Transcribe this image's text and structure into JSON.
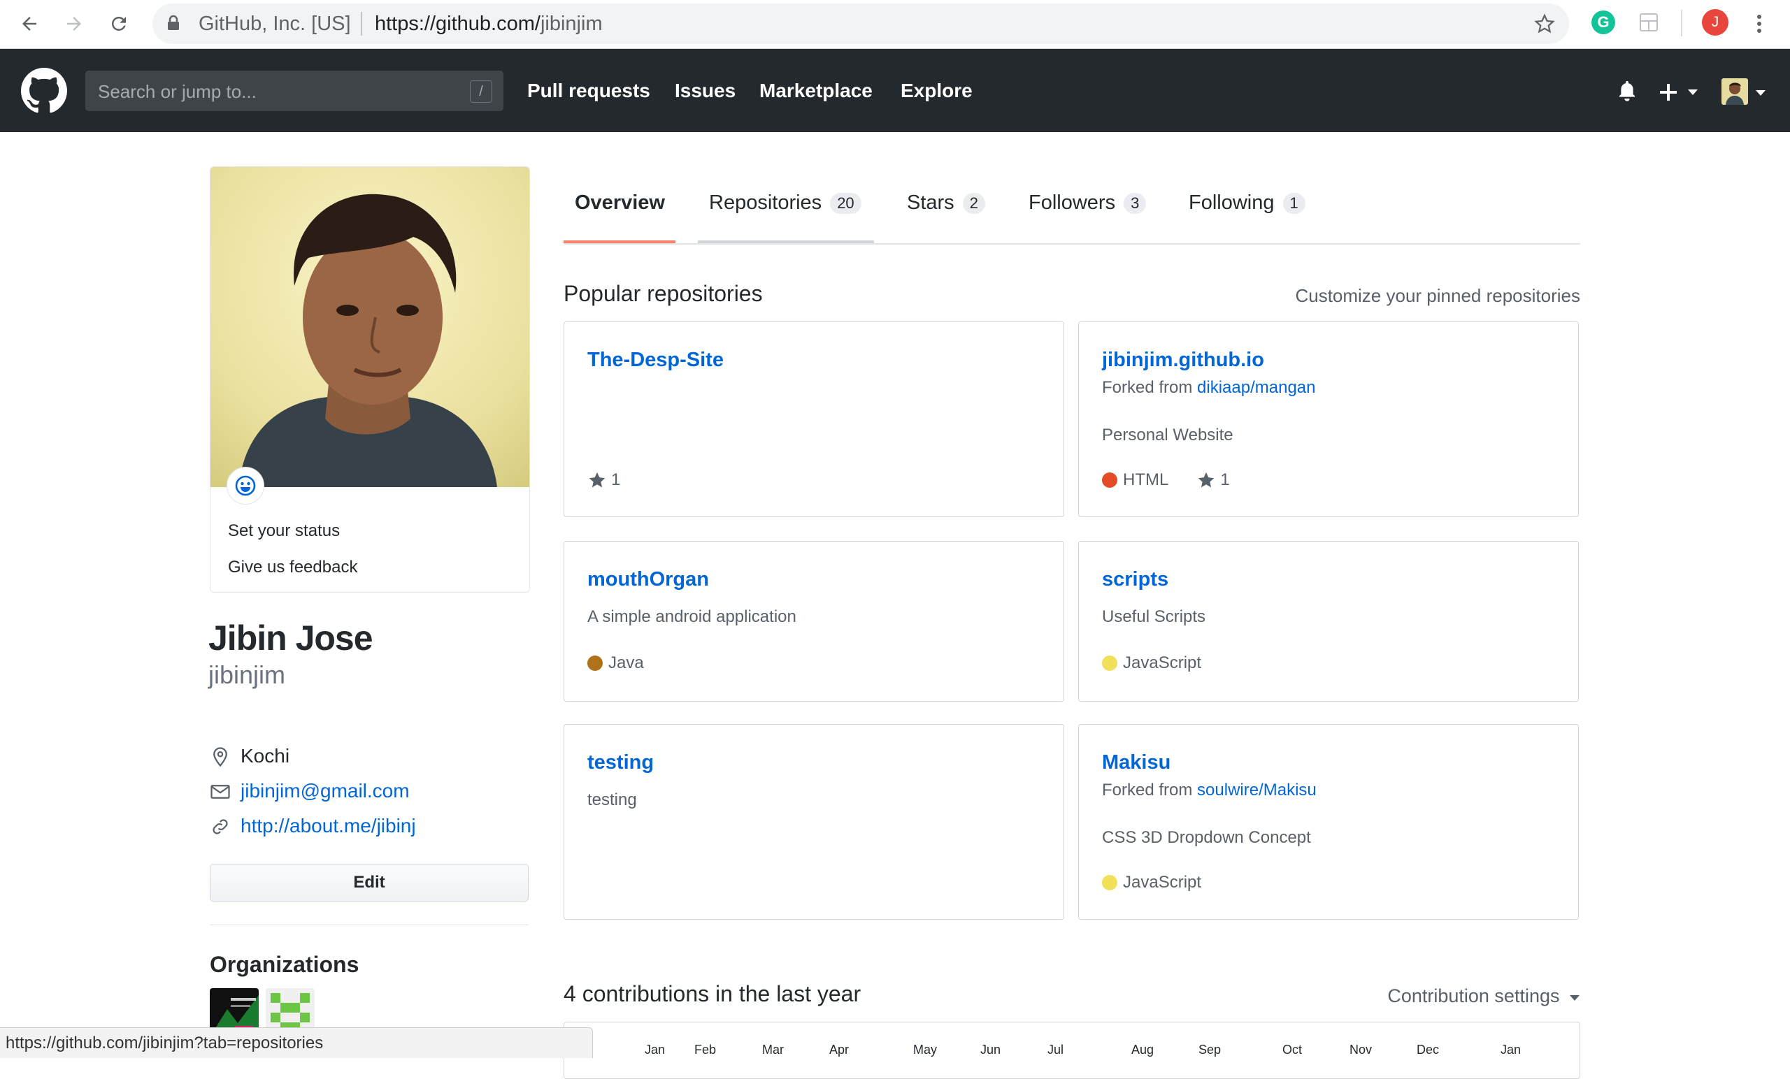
{
  "browser": {
    "security_label": "GitHub, Inc. [US]",
    "url_scheme_host": "https://github.com/",
    "url_path": "jibinjim",
    "extension_letter": "G",
    "profile_letter": "J"
  },
  "github_header": {
    "search_placeholder": "Search or jump to...",
    "search_shortcut": "/",
    "nav": [
      "Pull requests",
      "Issues",
      "Marketplace",
      "Explore"
    ]
  },
  "profile": {
    "status_menu": [
      "Set your status",
      "Give us feedback"
    ],
    "fullname": "Jibin Jose",
    "username": "jibinjim",
    "location": "Kochi",
    "email": "jibinjim@gmail.com",
    "website": "http://about.me/jibinj",
    "edit_label": "Edit",
    "organizations_title": "Organizations"
  },
  "tabs": [
    {
      "label": "Overview",
      "count": ""
    },
    {
      "label": "Repositories",
      "count": "20"
    },
    {
      "label": "Stars",
      "count": "2"
    },
    {
      "label": "Followers",
      "count": "3"
    },
    {
      "label": "Following",
      "count": "1"
    }
  ],
  "popular": {
    "title": "Popular repositories",
    "customize": "Customize your pinned repositories",
    "forked_from_label": "Forked from",
    "repos": [
      {
        "name": "The-Desp-Site",
        "forked_from": "",
        "description": "",
        "language": "",
        "language_color": "",
        "stars": "1"
      },
      {
        "name": "jibinjim.github.io",
        "forked_from": "dikiaap/mangan",
        "description": "Personal Website",
        "language": "HTML",
        "language_color": "#e34c26",
        "stars": "1"
      },
      {
        "name": "mouthOrgan",
        "forked_from": "",
        "description": "A simple android application",
        "language": "Java",
        "language_color": "#b07219",
        "stars": ""
      },
      {
        "name": "scripts",
        "forked_from": "",
        "description": "Useful Scripts",
        "language": "JavaScript",
        "language_color": "#f1e05a",
        "stars": ""
      },
      {
        "name": "testing",
        "forked_from": "",
        "description": "testing",
        "language": "",
        "language_color": "",
        "stars": ""
      },
      {
        "name": "Makisu",
        "forked_from": "soulwire/Makisu",
        "description": "CSS 3D Dropdown Concept",
        "language": "JavaScript",
        "language_color": "#f1e05a",
        "stars": ""
      }
    ]
  },
  "contributions": {
    "title": "4 contributions in the last year",
    "settings_label": "Contribution settings",
    "months": [
      "Jan",
      "Feb",
      "Mar",
      "Apr",
      "May",
      "Jun",
      "Jul",
      "Aug",
      "Sep",
      "Oct",
      "Nov",
      "Dec",
      "Jan"
    ]
  },
  "status_url": "https://github.com/jibinjim?tab=repositories",
  "colors": {
    "header_bg": "#24292e",
    "link_blue": "#0366d6",
    "tab_active_underline": "#f9826c"
  }
}
